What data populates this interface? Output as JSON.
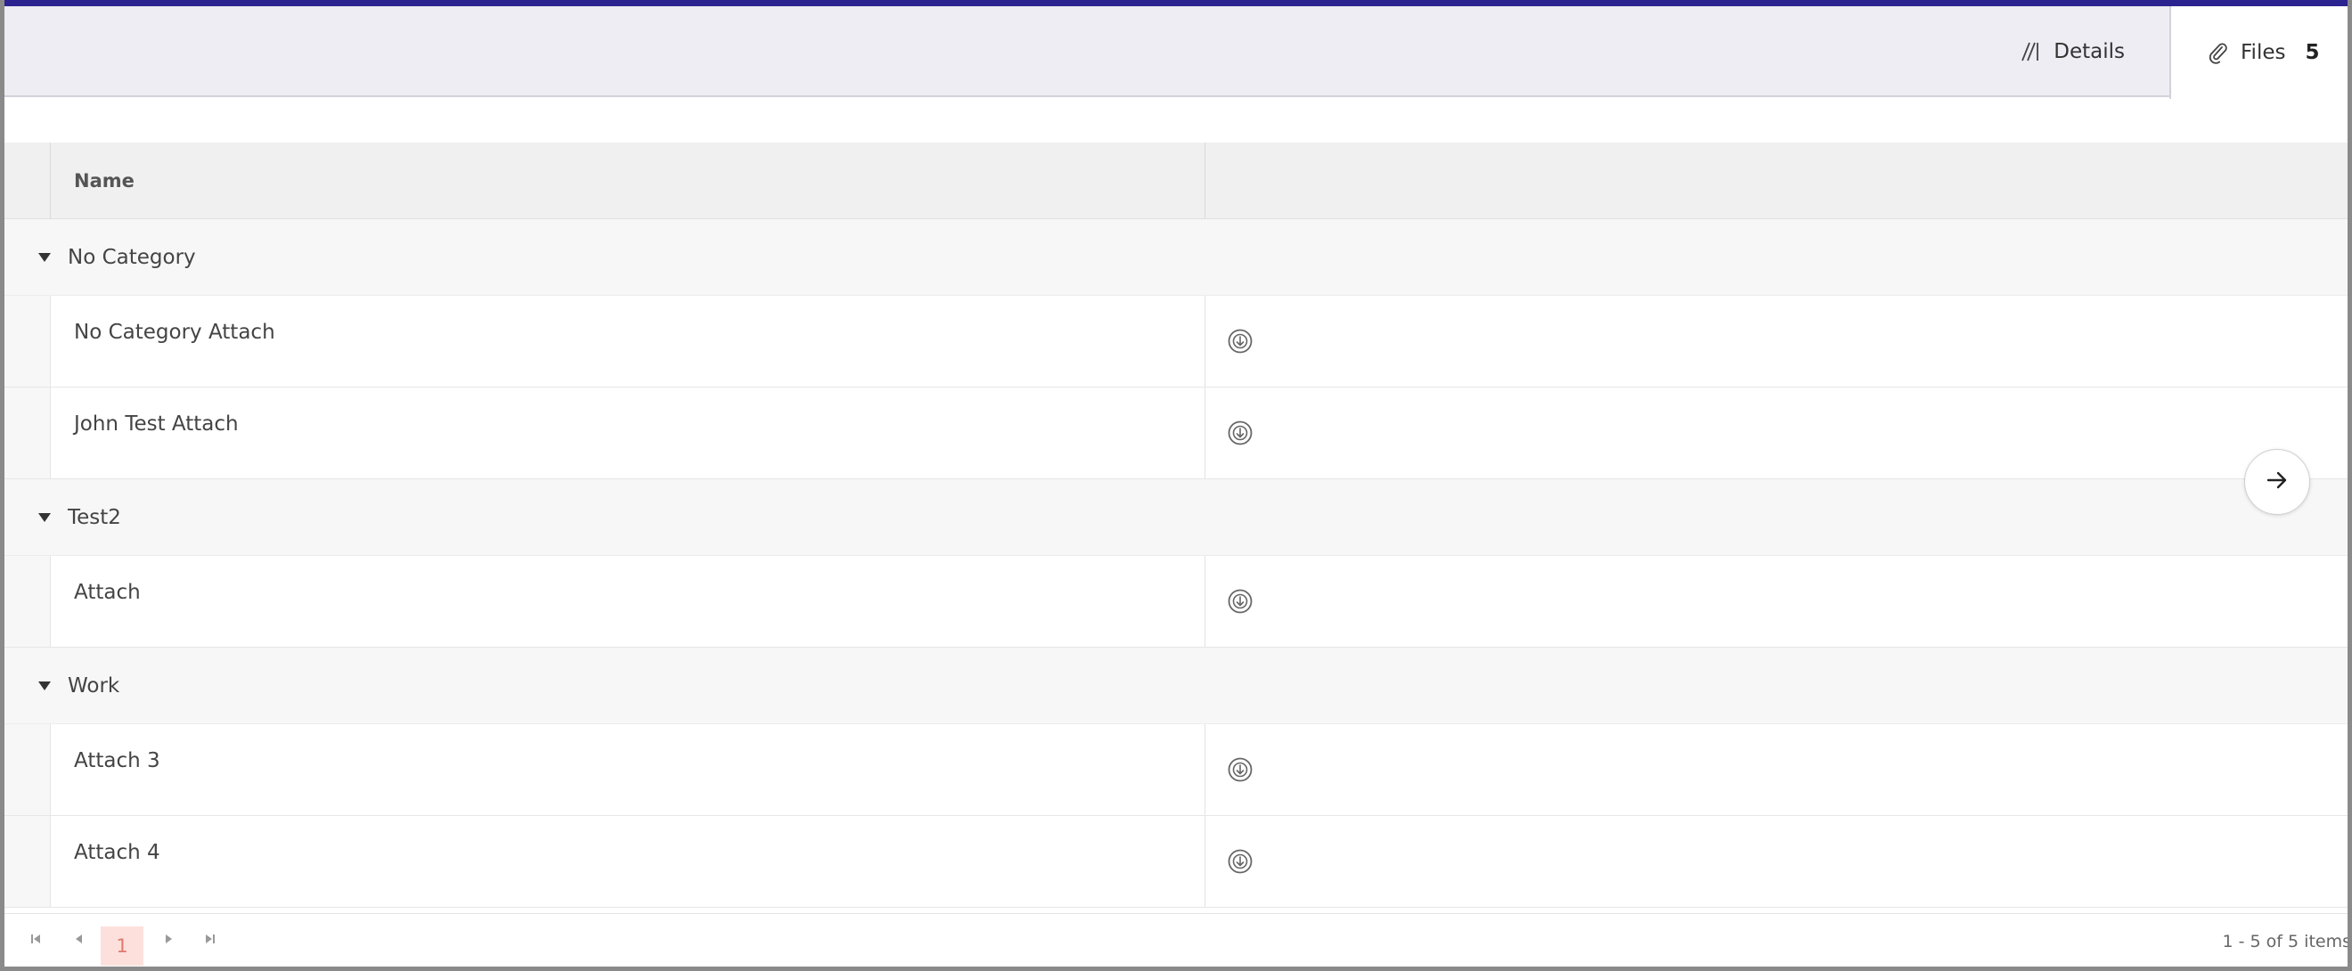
{
  "tabs": {
    "details": {
      "label": "Details",
      "icon": "slashes-icon"
    },
    "files": {
      "label": "Files",
      "count": "5",
      "icon": "paperclip-icon"
    }
  },
  "grid": {
    "header": {
      "name": "Name"
    },
    "groups": [
      {
        "label": "No Category",
        "rows": [
          {
            "name": "No Category Attach"
          },
          {
            "name": "John Test Attach"
          }
        ]
      },
      {
        "label": "Test2",
        "rows": [
          {
            "name": "Attach"
          }
        ]
      },
      {
        "label": "Work",
        "rows": [
          {
            "name": "Attach 3"
          },
          {
            "name": "Attach 4"
          }
        ]
      }
    ]
  },
  "pager": {
    "current_page": "1",
    "info": "1 - 5 of 5 items"
  },
  "colors": {
    "accent_strip": "#2b2490",
    "page_highlight": "#fde0dc",
    "page_text": "#e07a70"
  }
}
